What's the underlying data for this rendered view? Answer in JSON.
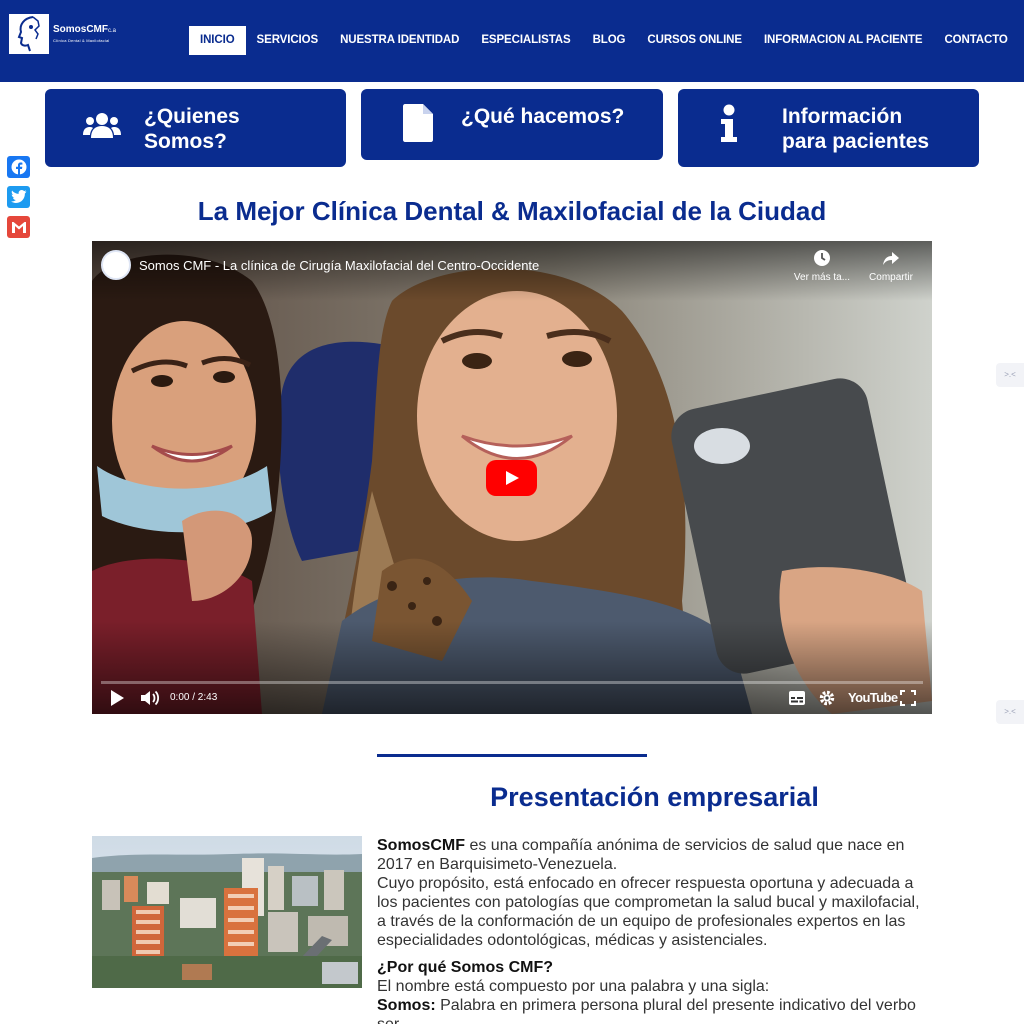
{
  "brand": {
    "name": "SomosCMF",
    "suffix": "c.a",
    "tagline": "Clínica Dental & Maxilofacial"
  },
  "nav": {
    "items": [
      "INICIO",
      "SERVICIOS",
      "NUESTRA IDENTIDAD",
      "ESPECIALISTAS",
      "BLOG",
      "CURSOS ONLINE",
      "INFORMACION AL PACIENTE",
      "CONTACTO"
    ],
    "active": "INICIO"
  },
  "features": [
    {
      "line1": "¿Quienes",
      "line2": "Somos?",
      "icon": "users-icon"
    },
    {
      "line1": "¿Qué hacemos?",
      "line2": "",
      "icon": "document-icon"
    },
    {
      "line1": "Información",
      "line2": "para pacientes",
      "icon": "info-icon"
    }
  ],
  "share": [
    "Facebook",
    "Twitter",
    "Gmail"
  ],
  "main_heading": "La Mejor Clínica Dental & Maxilofacial de la Ciudad",
  "video": {
    "title": "Somos CMF - La clínica de Cirugía Maxilofacial del Centro-Occidente",
    "watch_later": "Ver más ta...",
    "share": "Compartir",
    "time": "0:00 / 2:43",
    "youtube": "YouTube",
    "progress": 0
  },
  "side_widget_glyph": ">.<",
  "presentation": {
    "heading": "Presentación empresarial",
    "p1_bold": "SomosCMF",
    "p1_rest": " es una compañía anónima de servicios de salud que nace en 2017 en Barquisimeto-Venezuela.",
    "p2": "Cuyo propósito, está enfocado en ofrecer respuesta oportuna y adecuada a los pacientes con patologías que comprometan la salud bucal y maxilofacial, a través de la conformación de un equipo de profesionales expertos en las especialidades odontológicas, médicas y asistenciales.",
    "q_heading": "¿Por qué Somos CMF?",
    "q_text": "El nombre está compuesto por una palabra y una sigla:",
    "q_def_bold": "Somos:",
    "q_def_rest": " Palabra en primera persona plural del presente indicativo del verbo ser."
  },
  "colors": {
    "brand_blue": "#0a2c8f",
    "facebook": "#1877f2",
    "twitter": "#1d9bf0",
    "gmail": "#e5473b",
    "youtube_red": "#ff0000"
  }
}
